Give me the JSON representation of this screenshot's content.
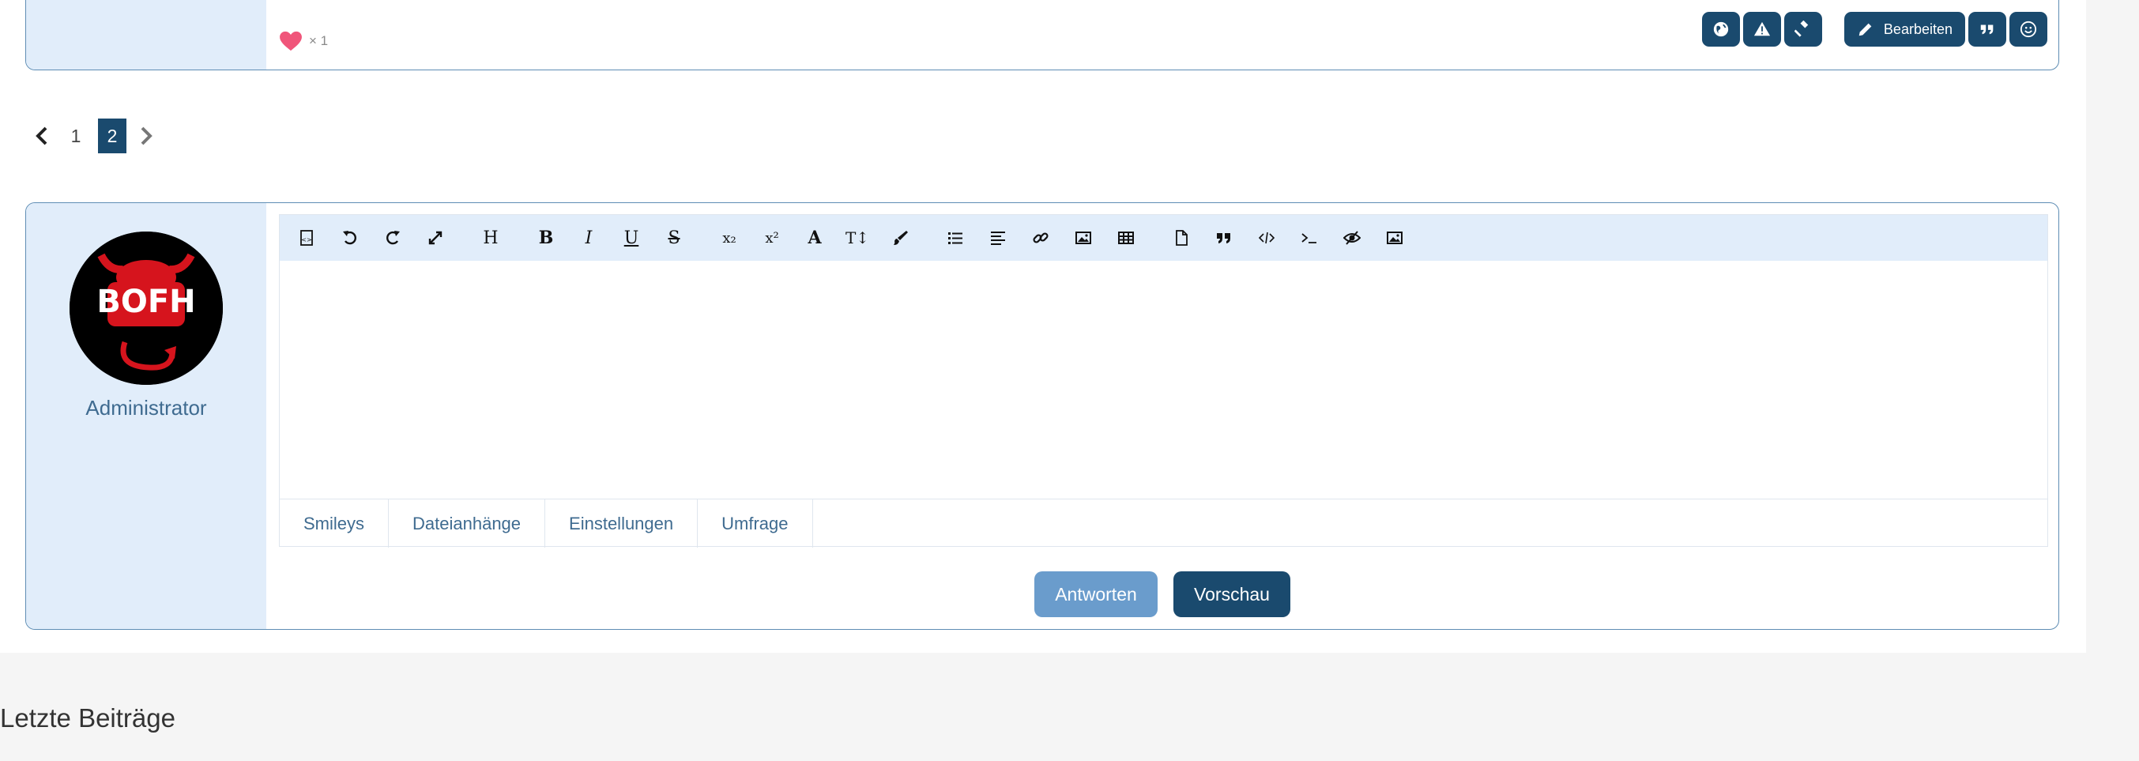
{
  "previous_post": {
    "like_count": "× 1",
    "actions": {
      "globe_icon": "globe-icon",
      "report_icon": "warning-icon",
      "moderate_icon": "gavel-icon",
      "edit_label": "Bearbeiten",
      "quote_icon": "quote-icon",
      "react_icon": "smiley-icon"
    }
  },
  "pagination": {
    "pages": [
      "1",
      "2"
    ],
    "current": "2"
  },
  "reply": {
    "username": "Administrator",
    "avatar_text": "BOFH",
    "toolbar_icons": [
      "source-icon",
      "undo-icon",
      "redo-icon",
      "maximize-icon",
      "heading-icon",
      "bold-icon",
      "italic-icon",
      "underline-icon",
      "strikethrough-icon",
      "subscript-icon",
      "superscript-icon",
      "font-icon",
      "font-size-icon",
      "color-icon",
      "list-icon",
      "align-icon",
      "link-icon",
      "image-icon",
      "table-icon",
      "file-icon",
      "quote-icon",
      "code-icon",
      "terminal-icon",
      "spoiler-icon",
      "media-icon"
    ],
    "toolbar_glyphs": {
      "heading": "H",
      "bold": "B",
      "italic": "I",
      "underline": "U",
      "strike": "S",
      "subscript": "x₂",
      "superscript": "x²",
      "font": "A",
      "fontsize": "T↕"
    },
    "tabs": [
      "Smileys",
      "Dateianhänge",
      "Einstellungen",
      "Umfrage"
    ],
    "submit_label": "Antworten",
    "preview_label": "Vorschau"
  },
  "section_title": "Letzte Beiträge",
  "colors": {
    "brand_dark": "#1a4a6e",
    "brand_light": "#6a9ccc",
    "sidebar_bg": "#e1edfa",
    "heart": "#f0557a"
  }
}
